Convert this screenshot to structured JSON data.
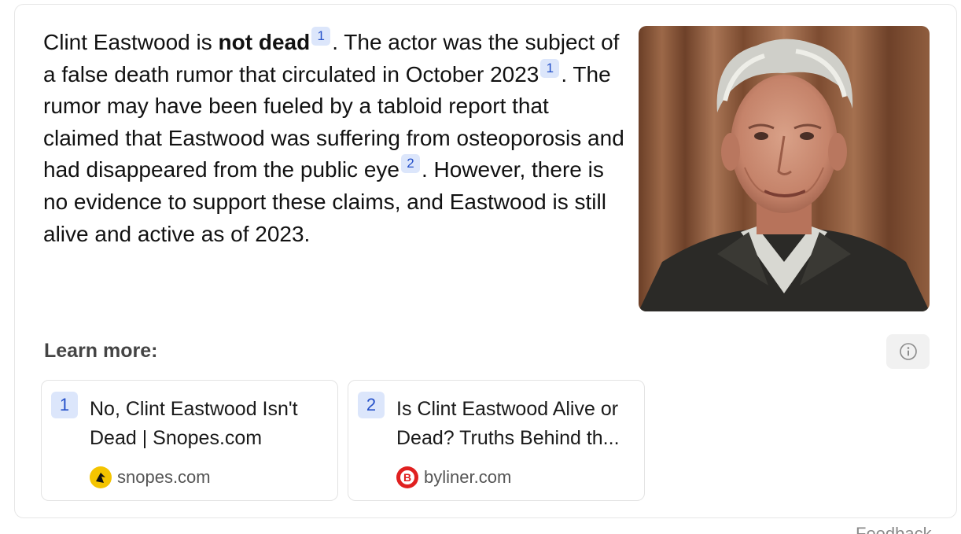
{
  "answer": {
    "part1": "Clint Eastwood is ",
    "bold": "not dead",
    "cite1": "1",
    "part2": ". The actor was the subject of a false death rumor that circulated in October 2023",
    "cite2": "1",
    "part3": ". The rumor may have been fueled by a tabloid report that claimed that Eastwood was suffering from osteoporosis and had disappeared from the public eye",
    "cite3": "2",
    "part4": ". However, there is no evidence to support these claims, and Eastwood is still alive and active as of 2023."
  },
  "learn_more": {
    "heading": "Learn more:"
  },
  "sources": [
    {
      "number": "1",
      "title": "No, Clint Eastwood Isn't Dead | Snopes.com",
      "domain": "snopes.com",
      "favicon": "snopes-logo-icon"
    },
    {
      "number": "2",
      "title": "Is Clint Eastwood Alive or Dead? Truths Behind th...",
      "domain": "byliner.com",
      "favicon": "byliner-logo-icon"
    }
  ],
  "feedback_label": "Feedback",
  "colors": {
    "citation_bg": "#dce6fb",
    "citation_text": "#2450c9"
  }
}
